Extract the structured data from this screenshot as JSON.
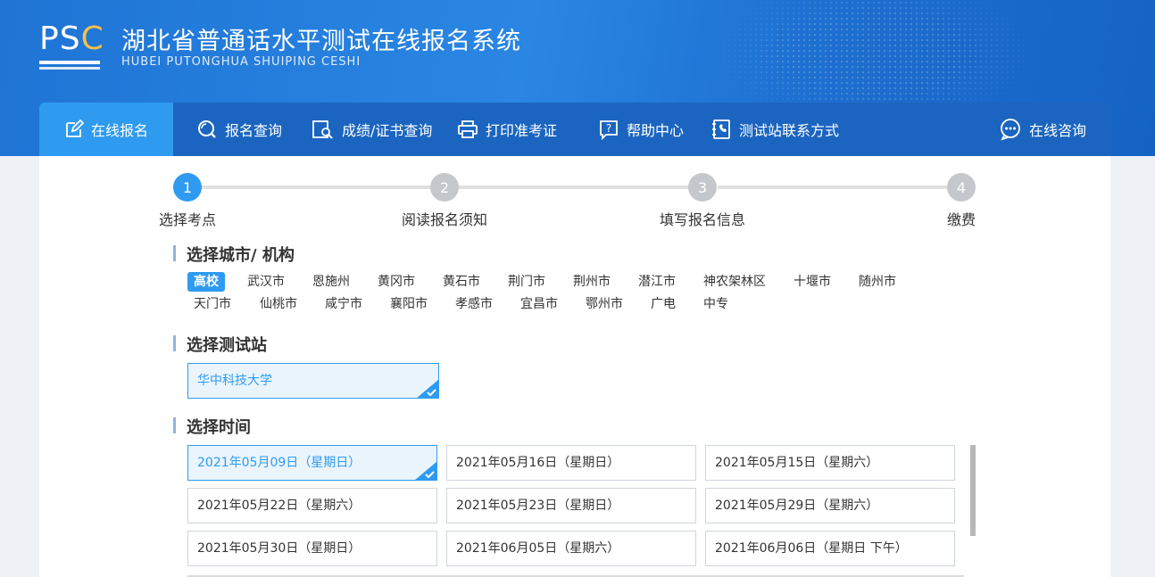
{
  "header": {
    "logo_text": "PSC",
    "title": "湖北省普通话水平测试在线报名系统",
    "subtitle": "HUBEI PUTONGHUA SHUIPING CESHI"
  },
  "nav": {
    "items": [
      {
        "label": "在线报名",
        "icon": "edit-icon",
        "active": true
      },
      {
        "label": "报名查询",
        "icon": "search-circle-icon"
      },
      {
        "label": "成绩/证书查询",
        "icon": "document-search-icon"
      },
      {
        "label": "打印准考证",
        "icon": "printer-icon"
      },
      {
        "label": "帮助中心",
        "icon": "help-icon"
      },
      {
        "label": "测试站联系方式",
        "icon": "phone-book-icon"
      }
    ],
    "consult": {
      "label": "在线咨询",
      "icon": "chat-icon"
    }
  },
  "steps": [
    {
      "num": "1",
      "label": "选择考点",
      "active": true
    },
    {
      "num": "2",
      "label": "阅读报名须知"
    },
    {
      "num": "3",
      "label": "填写报名信息"
    },
    {
      "num": "4",
      "label": "缴费"
    }
  ],
  "city_section": {
    "title": "选择城市/ 机构",
    "row1": [
      "高校",
      "武汉市",
      "恩施州",
      "黄冈市",
      "黄石市",
      "荆门市",
      "荆州市",
      "潜江市",
      "神农架林区",
      "十堰市",
      "随州市"
    ],
    "row2": [
      "天门市",
      "仙桃市",
      "咸宁市",
      "襄阳市",
      "孝感市",
      "宜昌市",
      "鄂州市",
      "广电",
      "中专"
    ],
    "selected": "高校"
  },
  "station_section": {
    "title": "选择测试站",
    "selected": "华中科技大学"
  },
  "time_section": {
    "title": "选择时间",
    "options": [
      "2021年05月09日（星期日）",
      "2021年05月16日（星期日）",
      "2021年05月15日（星期六）",
      "2021年05月22日（星期六）",
      "2021年05月23日（星期日）",
      "2021年05月29日（星期六）",
      "2021年05月30日（星期日）",
      "2021年06月05日（星期六）",
      "2021年06月06日（星期日 下午）"
    ],
    "selected_index": 0
  },
  "colors": {
    "accent": "#2e9bf0",
    "nav": "#1b65c0",
    "header": "#2a86e3"
  }
}
